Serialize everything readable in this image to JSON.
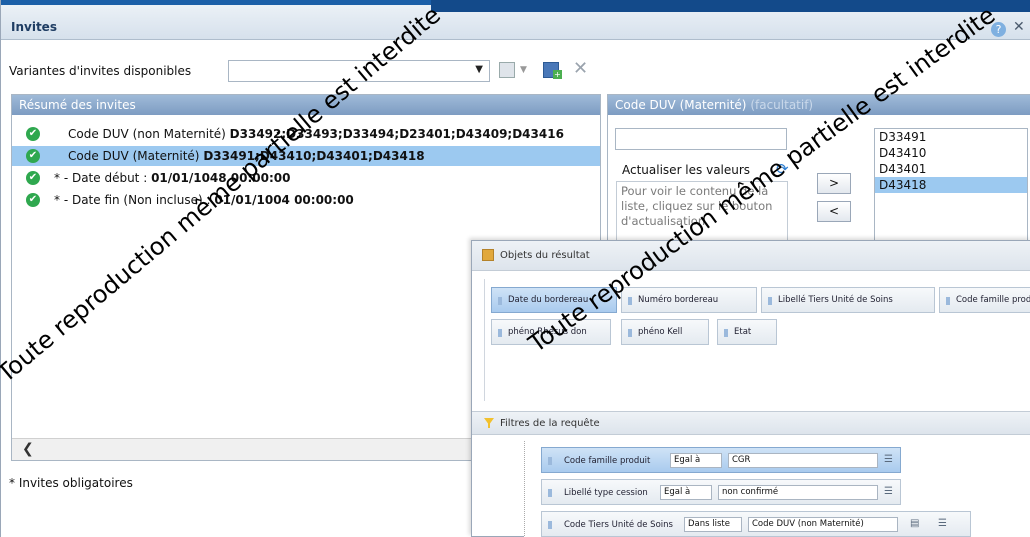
{
  "dialog": {
    "title": "Invites",
    "help_glyph": "?",
    "close_glyph": "✕"
  },
  "variants": {
    "label": "Variantes d'invites disponibles",
    "selected": ""
  },
  "summary": {
    "header": "Résumé des invites",
    "rows": [
      {
        "prefix": "Code DUV (non Maternité) ",
        "value": "D33492;D33493;D33494;D23401;D43409;D43416"
      },
      {
        "prefix": "Code DUV (Maternité) ",
        "value": "D33491;D43410;D43401;D43418"
      },
      {
        "prefix": "* - Date début : ",
        "value": "01/01/1048 00:00:00"
      },
      {
        "prefix": "* - Date fin (Non incluse) : ",
        "value": "01/01/1004 00:00:00"
      }
    ],
    "scroll_left_glyph": "❮",
    "mandatory_note": "* Invites obligatoires"
  },
  "right_panel": {
    "header": "Code DUV (Maternité) ",
    "header_optional": "(facultatif)",
    "refresh_label": "Actualiser les valeurs",
    "hint": "Pour voir le contenu de la liste, cliquez sur le bouton d'actualisation.",
    "add_label": ">",
    "remove_label": "<",
    "values": [
      "D33491",
      "D43410",
      "D43401",
      "D43418"
    ]
  },
  "query": {
    "objects_title": "Objets du résultat",
    "objects": [
      "Date du bordereau",
      "Numéro bordereau",
      "Libellé Tiers Unité de Soins",
      "Code famille produit",
      "phéno Rhésus don",
      "phéno Kell",
      "Etat"
    ],
    "filters_title": "Filtres de la requête",
    "filters": [
      {
        "name": "Code famille produit",
        "op": "Egal à",
        "value": "CGR"
      },
      {
        "name": "Libellé type cession",
        "op": "Egal à",
        "value": "non confirmé"
      },
      {
        "name": "Code Tiers Unité de Soins",
        "op": "Dans liste",
        "value": "Code DUV (non Maternité)"
      }
    ]
  },
  "watermark": {
    "line1": "Toute reproduction même partielle est interdite",
    "line2": "Toute reproduction même partielle est interdite"
  },
  "colors": {
    "header_blue": "#7d9cc2",
    "selected_row": "#9cc9f0",
    "check_green": "#2fa84f"
  }
}
